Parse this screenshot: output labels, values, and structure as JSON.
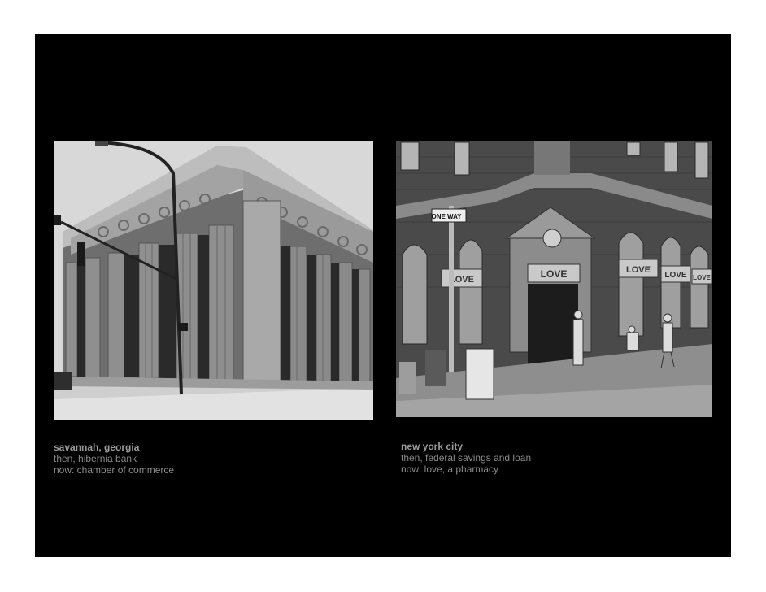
{
  "panels": [
    {
      "place": "savannah, georgia",
      "then": "then, hibernia bank",
      "now": "now: chamber of commerce"
    },
    {
      "place": "new york city",
      "then": "then, federal savings and loan",
      "now": "now: love, a pharmacy"
    }
  ],
  "signs": {
    "one_way": "ONE WAY",
    "store_left": "LOVE",
    "store_door": "LOVE",
    "store_window": "LOVE",
    "store_window2": "LOVE",
    "store_window3": "LOVE"
  },
  "colors": {
    "slide_background": "#000000",
    "page_background": "#ffffff",
    "caption_text": "#8a8a8a"
  }
}
